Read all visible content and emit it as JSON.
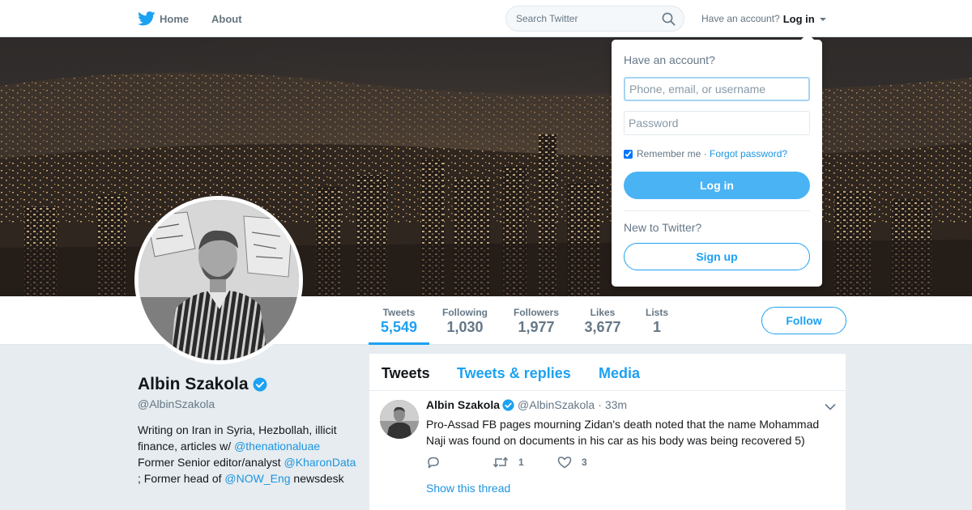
{
  "nav": {
    "home_label": "Home",
    "about_label": "About",
    "search_placeholder": "Search Twitter",
    "have_account": "Have an account?",
    "login_label": "Log in"
  },
  "profile": {
    "name": "Albin Szakola",
    "handle": "@AlbinSzakola",
    "bio": {
      "t1": "Writing on Iran in Syria, Hezbollah, illicit finance, articles w/ ",
      "link1": "@thenationaluae",
      "t2": " Former Senior editor/analyst ",
      "link2": "@KharonData",
      "t3": " ; Former head of ",
      "link3": "@NOW_Eng",
      "t4": " newsdesk"
    }
  },
  "stats": [
    {
      "label": "Tweets",
      "value": "5,549"
    },
    {
      "label": "Following",
      "value": "1,030"
    },
    {
      "label": "Followers",
      "value": "1,977"
    },
    {
      "label": "Likes",
      "value": "3,677"
    },
    {
      "label": "Lists",
      "value": "1"
    }
  ],
  "follow_label": "Follow",
  "timeline": {
    "tabs": [
      "Tweets",
      "Tweets & replies",
      "Media"
    ],
    "tweet": {
      "name": "Albin Szakola",
      "handle": "@AlbinSzakola",
      "dot": "·",
      "time": "33m",
      "text": "Pro-Assad FB pages mourning Zidan's death noted that the name Mohammad Naji was found on documents in his car as his body was being recovered 5)",
      "retweets": "1",
      "likes": "3",
      "show_thread": "Show this thread"
    }
  },
  "login_dropdown": {
    "heading": "Have an account?",
    "username_placeholder": "Phone, email, or username",
    "password_placeholder": "Password",
    "remember_label": "Remember me",
    "separator": " · ",
    "forgot_label": "Forgot password?",
    "login_button": "Log in",
    "new_label": "New to Twitter?",
    "signup_button": "Sign up"
  },
  "colors": {
    "accent": "#1da1f2",
    "link": "#1b95e0",
    "login_button": "#4ab3f4"
  }
}
